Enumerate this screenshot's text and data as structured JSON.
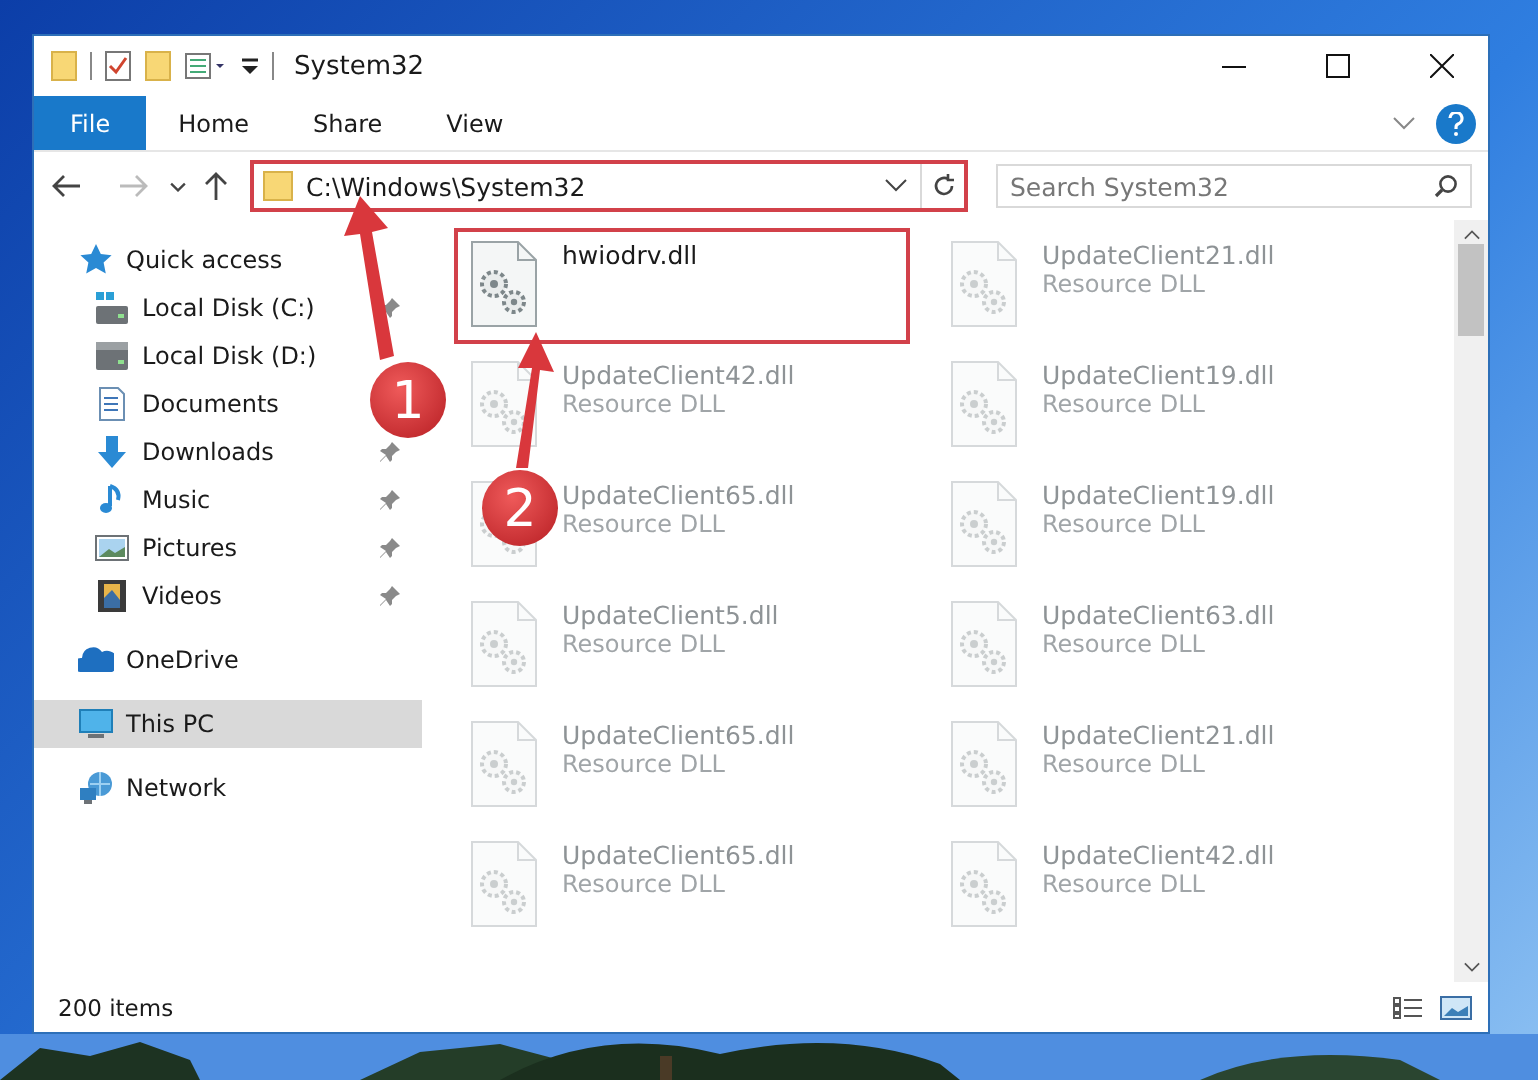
{
  "window": {
    "title": "System32"
  },
  "ribbon": {
    "tabs": [
      {
        "label": "File",
        "selected": true
      },
      {
        "label": "Home",
        "selected": false
      },
      {
        "label": "Share",
        "selected": false
      },
      {
        "label": "View",
        "selected": false
      }
    ]
  },
  "address_bar": {
    "path": "C:\\Windows\\System32",
    "highlighted": true
  },
  "search": {
    "placeholder": "Search System32"
  },
  "sidebar": {
    "items": [
      {
        "label": "Quick access",
        "kind": "quick-access",
        "selected": false,
        "pinned": false,
        "children": [
          {
            "label": "Local Disk (C:)",
            "kind": "system-drive",
            "selected": false,
            "pinned": true
          },
          {
            "label": "Local Disk (D:)",
            "kind": "drive",
            "selected": false,
            "pinned": false
          },
          {
            "label": "Documents",
            "kind": "documents",
            "selected": false,
            "pinned": false
          },
          {
            "label": "Downloads",
            "kind": "downloads",
            "selected": false,
            "pinned": true
          },
          {
            "label": "Music",
            "kind": "music",
            "selected": false,
            "pinned": true
          },
          {
            "label": "Pictures",
            "kind": "pictures",
            "selected": false,
            "pinned": true
          },
          {
            "label": "Videos",
            "kind": "videos",
            "selected": false,
            "pinned": true
          }
        ]
      },
      {
        "label": "OneDrive",
        "kind": "cloud",
        "selected": false,
        "pinned": false
      },
      {
        "label": "This PC",
        "kind": "computer",
        "selected": true,
        "pinned": false
      },
      {
        "label": "Network",
        "kind": "network",
        "selected": false,
        "pinned": false
      }
    ]
  },
  "files": [
    {
      "name": "hwiodrv.dll",
      "highlighted": true,
      "dimmed": false
    },
    {
      "name": "UpdateClient21.dll",
      "type": "Resource DLL",
      "highlighted": false,
      "dimmed": true
    },
    {
      "name": "UpdateClient42.dll",
      "type": "Resource DLL",
      "highlighted": false,
      "dimmed": true
    },
    {
      "name": "UpdateClient19.dll",
      "type": "Resource DLL",
      "highlighted": false,
      "dimmed": true
    },
    {
      "name": "UpdateClient65.dll",
      "type": "Resource DLL",
      "highlighted": false,
      "dimmed": true
    },
    {
      "name": "UpdateClient19.dll",
      "type": "Resource DLL",
      "highlighted": false,
      "dimmed": true
    },
    {
      "name": "UpdateClient5.dll",
      "type": "Resource DLL",
      "highlighted": false,
      "dimmed": true
    },
    {
      "name": "UpdateClient63.dll",
      "type": "Resource DLL",
      "highlighted": false,
      "dimmed": true
    },
    {
      "name": "UpdateClient65.dll",
      "type": "Resource DLL",
      "highlighted": false,
      "dimmed": true
    },
    {
      "name": "UpdateClient21.dll",
      "type": "Resource DLL",
      "highlighted": false,
      "dimmed": true
    },
    {
      "name": "UpdateClient65.dll",
      "type": "Resource DLL",
      "highlighted": false,
      "dimmed": true
    },
    {
      "name": "UpdateClient42.dll",
      "type": "Resource DLL",
      "highlighted": false,
      "dimmed": true
    }
  ],
  "status_bar": {
    "item_count": "200 items"
  },
  "annotations": [
    {
      "label": "1"
    },
    {
      "label": "2"
    }
  ]
}
